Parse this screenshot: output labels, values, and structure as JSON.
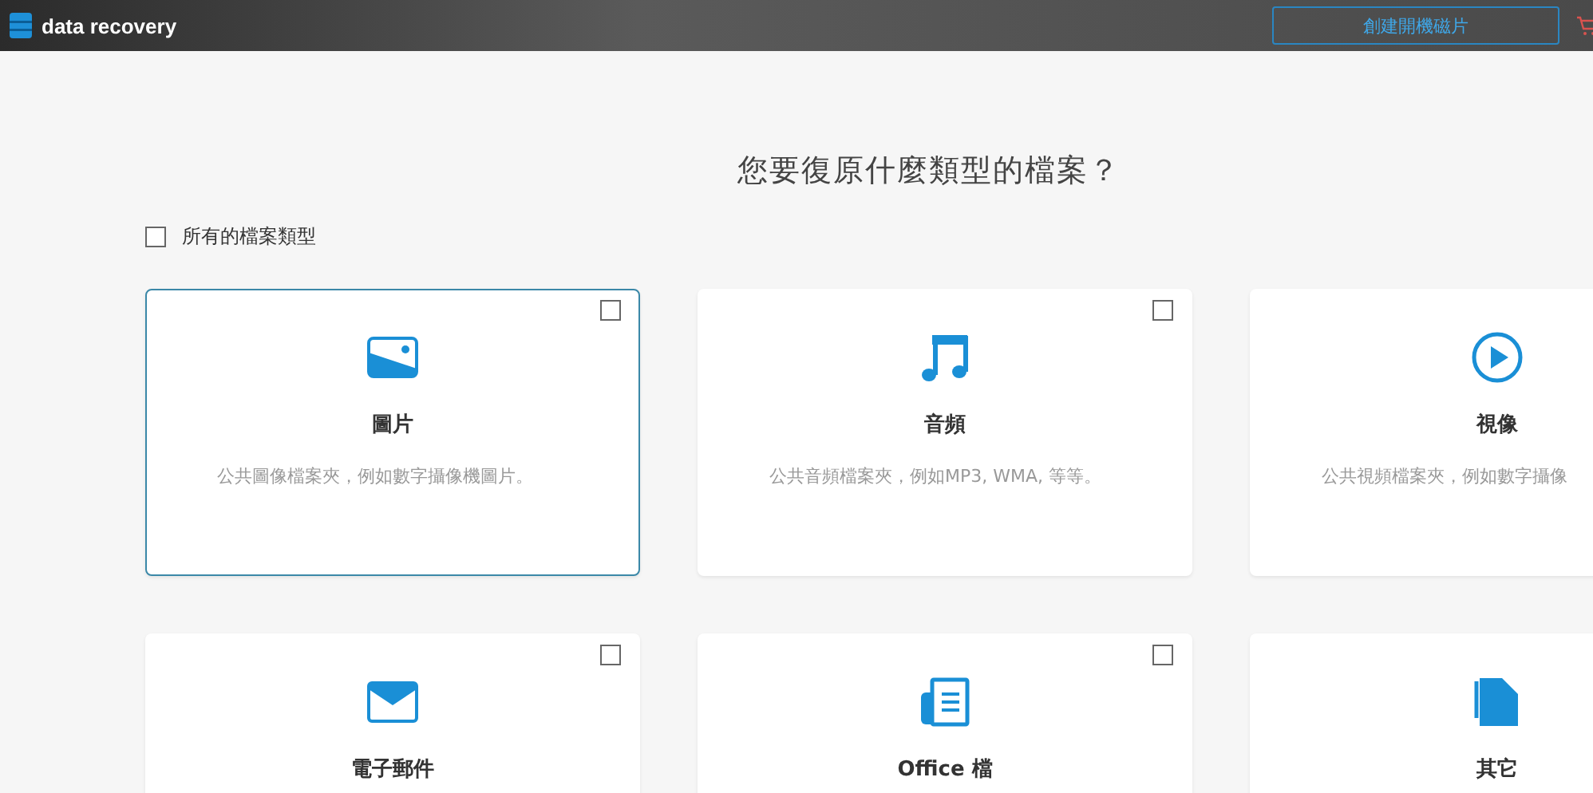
{
  "app": {
    "title": "data recovery",
    "bootable_button": "創建開機磁片"
  },
  "heading": "您要復原什麼類型的檔案？",
  "all_types": {
    "label": "所有的檔案類型",
    "checked": false
  },
  "cards": [
    {
      "kind": "image",
      "title": "圖片",
      "description": "公共圖像檔案夾，例如數字攝像機圖片。",
      "selected": true,
      "checked": false
    },
    {
      "kind": "audio",
      "title": "音頻",
      "description": "公共音頻檔案夾，例如MP3, WMA, 等等。",
      "selected": false,
      "checked": false
    },
    {
      "kind": "video",
      "title": "視像",
      "description": "公共視頻檔案夾，例如數字攝像",
      "selected": false
    },
    {
      "kind": "email",
      "title": "電子郵件",
      "selected": false,
      "checked": false
    },
    {
      "kind": "office",
      "title": "Office 檔",
      "selected": false,
      "checked": false
    },
    {
      "kind": "other",
      "title": "其它",
      "selected": false
    }
  ]
}
